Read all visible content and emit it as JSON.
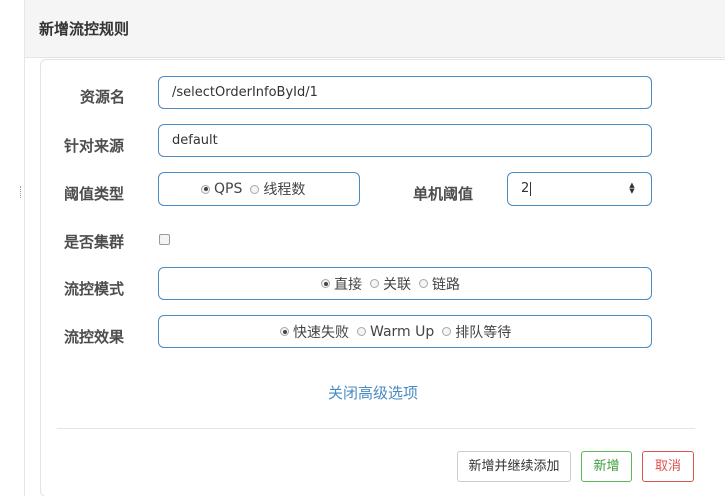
{
  "dialog": {
    "title": "新增流控规则"
  },
  "form": {
    "resource_label": "资源名",
    "resource_value": "/selectOrderInfoById/1",
    "source_label": "针对来源",
    "source_value": "default",
    "threshold_type_label": "阈值类型",
    "threshold_type_options": [
      "QPS",
      "线程数"
    ],
    "threshold_type_selected": "QPS",
    "single_threshold_label": "单机阈值",
    "single_threshold_value": "2",
    "cluster_label": "是否集群",
    "cluster_checked": false,
    "flow_mode_label": "流控模式",
    "flow_mode_options": [
      "直接",
      "关联",
      "链路"
    ],
    "flow_mode_selected": "直接",
    "flow_effect_label": "流控效果",
    "flow_effect_options": [
      "快速失败",
      "Warm Up",
      "排队等待"
    ],
    "flow_effect_selected": "快速失败",
    "advanced_toggle": "关闭高级选项"
  },
  "footer": {
    "continue_add_label": "新增并继续添加",
    "add_label": "新增",
    "cancel_label": "取消"
  },
  "colors": {
    "accent": "#4a8bc1",
    "success": "#5cb85c",
    "danger": "#d9534f"
  },
  "icons": {
    "spinner": "up-down-arrows-icon"
  }
}
